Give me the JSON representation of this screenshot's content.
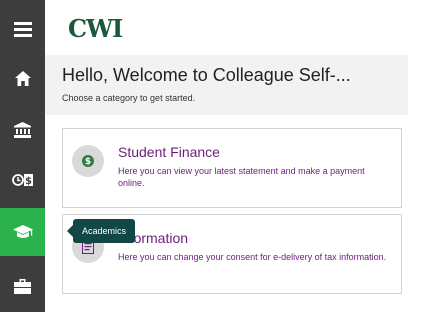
{
  "nav": {
    "items": [
      {
        "icon": "menu-icon"
      },
      {
        "icon": "home-icon"
      },
      {
        "icon": "bank-icon"
      },
      {
        "icon": "timecard-icon"
      },
      {
        "icon": "graduation-cap-icon",
        "active": true
      },
      {
        "icon": "briefcase-icon"
      }
    ],
    "tooltip": "Academics",
    "active_color": "#2bb24c"
  },
  "header": {
    "logo": "CWI"
  },
  "welcome": {
    "title": "Hello, Welcome to Colleague Self-...",
    "subtitle": "Choose a category to get started."
  },
  "cards": [
    {
      "title": "Student Finance",
      "description": "Here you can view your latest statement and make a payment online.",
      "icon": "dollar-icon"
    },
    {
      "title": "Information",
      "description": "Here you can change your consent for e-delivery of tax information.",
      "icon": "document-icon"
    }
  ]
}
